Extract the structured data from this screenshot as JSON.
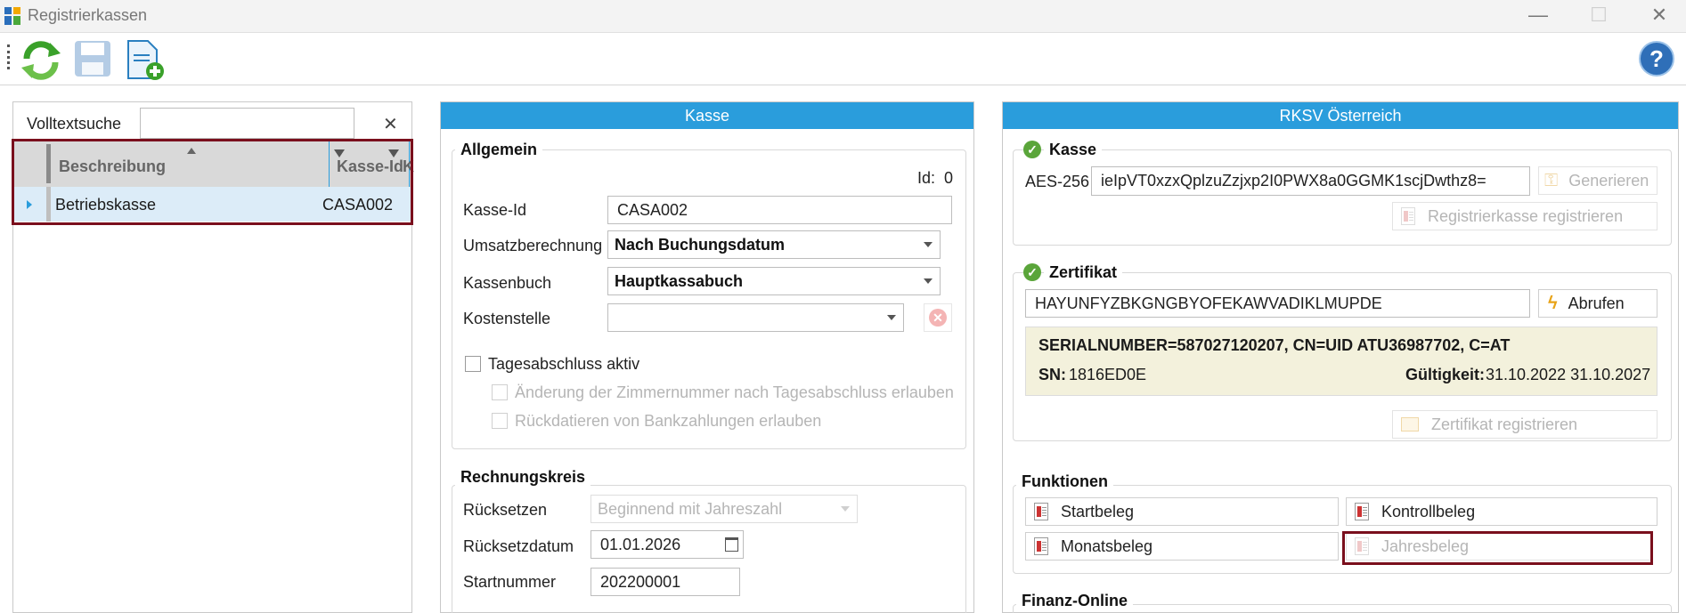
{
  "window": {
    "title": "Registrierkassen",
    "minimize": "—",
    "maximize": "☐",
    "close": "✕"
  },
  "search": {
    "label": "Volltextsuche",
    "value": "",
    "clear": "✕"
  },
  "grid": {
    "columns": [
      "Beschreibung",
      "Kasse-Id",
      "K"
    ],
    "rows": [
      {
        "beschreibung": "Betriebskasse",
        "kasse_id": "CASA002"
      }
    ]
  },
  "kasse": {
    "header": "Kasse",
    "allgemein": {
      "title": "Allgemein",
      "id_label": "Id:",
      "id_value": "0",
      "kasse_id_label": "Kasse-Id",
      "kasse_id_value": "CASA002",
      "umsatz_label": "Umsatzberechnung",
      "umsatz_value": "Nach Buchungsdatum",
      "kassenbuch_label": "Kassenbuch",
      "kassenbuch_value": "Hauptkassabuch",
      "kostenstelle_label": "Kostenstelle",
      "kostenstelle_value": "",
      "tagesabschluss_label": "Tagesabschluss aktiv",
      "zimmer_label": "Änderung der Zimmernummer nach Tagesabschluss erlauben",
      "rueckdatieren_label": "Rückdatieren von Bankzahlungen erlauben"
    },
    "rechnungskreis": {
      "title": "Rechnungskreis",
      "ruecksetzen_label": "Rücksetzen",
      "ruecksetzen_value": "Beginnend mit Jahreszahl",
      "datum_label": "Rücksetzdatum",
      "datum_value": "01.01.2026",
      "startnummer_label": "Startnummer",
      "startnummer_value": "202200001"
    }
  },
  "rksv": {
    "header": "RKSV Österreich",
    "kasse_group": {
      "title": "Kasse",
      "aes_label": "AES-256",
      "aes_value": "ieIpVT0xzxQplzuZzjxp2I0PWX8a0GGMK1scjDwthz8=",
      "generieren": "Generieren",
      "registrieren": "Registrierkasse registrieren"
    },
    "zertifikat_group": {
      "title": "Zertifikat",
      "value": "HAYUNFYZBKGNGBYOFEKAWVADIKLMUPDE",
      "abrufen": "Abrufen",
      "serial_line": "SERIALNUMBER=587027120207, CN=UID ATU36987702, C=AT",
      "sn_label": "SN:",
      "sn_value": "1816ED0E",
      "gueltig_label": "Gültigkeit:",
      "gueltig_value": "31.10.2022 31.10.2027",
      "registrieren": "Zertifikat registrieren"
    },
    "funktionen": {
      "title": "Funktionen",
      "startbeleg": "Startbeleg",
      "kontrollbeleg": "Kontrollbeleg",
      "monatsbeleg": "Monatsbeleg",
      "jahresbeleg": "Jahresbeleg"
    },
    "finanz_online": {
      "title": "Finanz-Online"
    }
  },
  "colors": {
    "accent": "#2a9ddc",
    "highlight": "#7a0f1d",
    "cert_bg": "#f3f1dc",
    "success": "#5aa53a"
  }
}
